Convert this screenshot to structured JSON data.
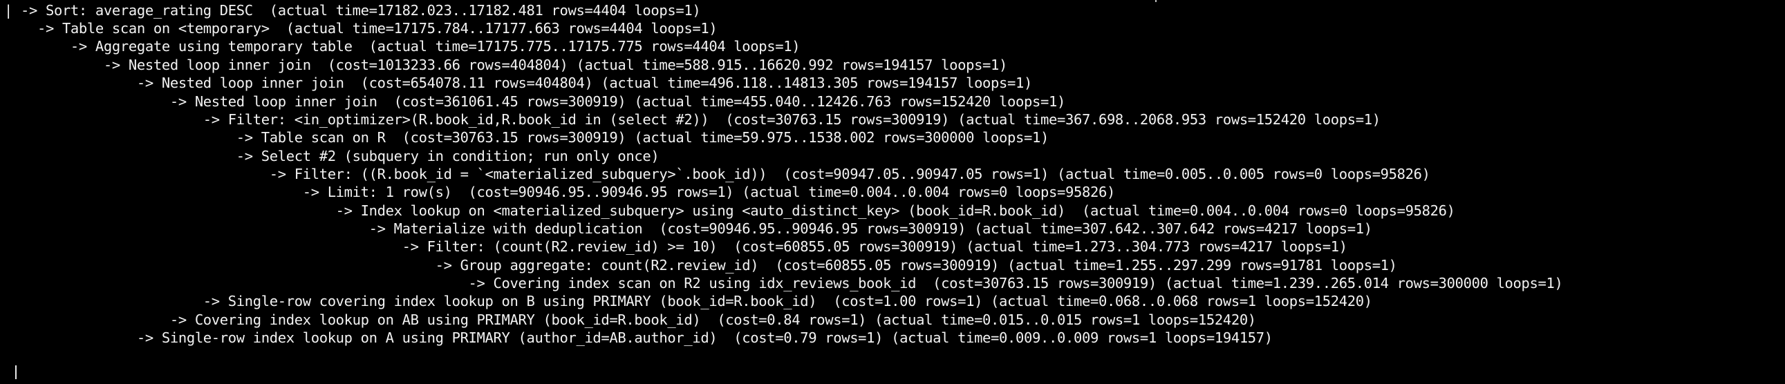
{
  "terminal": {
    "lines": [
      "| -> Sort: average_rating DESC  (actual time=17182.023..17182.481 rows=4404 loops=1)",
      "    -> Table scan on <temporary>  (actual time=17175.784..17177.663 rows=4404 loops=1)",
      "        -> Aggregate using temporary table  (actual time=17175.775..17175.775 rows=4404 loops=1)",
      "            -> Nested loop inner join  (cost=1013233.66 rows=404804) (actual time=588.915..16620.992 rows=194157 loops=1)",
      "                -> Nested loop inner join  (cost=654078.11 rows=404804) (actual time=496.118..14813.305 rows=194157 loops=1)",
      "                    -> Nested loop inner join  (cost=361061.45 rows=300919) (actual time=455.040..12426.763 rows=152420 loops=1)",
      "                        -> Filter: <in_optimizer>(R.book_id,R.book_id in (select #2))  (cost=30763.15 rows=300919) (actual time=367.698..2068.953 rows=152420 loops=1)",
      "                            -> Table scan on R  (cost=30763.15 rows=300919) (actual time=59.975..1538.002 rows=300000 loops=1)",
      "                            -> Select #2 (subquery in condition; run only once)",
      "                                -> Filter: ((R.book_id = `<materialized_subquery>`.book_id))  (cost=90947.05..90947.05 rows=1) (actual time=0.005..0.005 rows=0 loops=95826)",
      "                                    -> Limit: 1 row(s)  (cost=90946.95..90946.95 rows=1) (actual time=0.004..0.004 rows=0 loops=95826)",
      "                                        -> Index lookup on <materialized_subquery> using <auto_distinct_key> (book_id=R.book_id)  (actual time=0.004..0.004 rows=0 loops=95826)",
      "                                            -> Materialize with deduplication  (cost=90946.95..90946.95 rows=300919) (actual time=307.642..307.642 rows=4217 loops=1)",
      "                                                -> Filter: (count(R2.review_id) >= 10)  (cost=60855.05 rows=300919) (actual time=1.273..304.773 rows=4217 loops=1)",
      "                                                    -> Group aggregate: count(R2.review_id)  (cost=60855.05 rows=300919) (actual time=1.255..297.299 rows=91781 loops=1)",
      "                                                        -> Covering index scan on R2 using idx_reviews_book_id  (cost=30763.15 rows=300919) (actual time=1.239..265.014 rows=300000 loops=1)",
      "                        -> Single-row covering index lookup on B using PRIMARY (book_id=R.book_id)  (cost=1.00 rows=1) (actual time=0.068..0.068 rows=1 loops=152420)",
      "                    -> Covering index lookup on AB using PRIMARY (book_id=R.book_id)  (cost=0.84 rows=1) (actual time=0.015..0.015 rows=1 loops=152420)",
      "                -> Single-row index lookup on A using PRIMARY (author_id=AB.author_id)  (cost=0.79 rows=1) (actual time=0.009..0.009 rows=1 loops=194157)"
    ]
  },
  "colors": {
    "background": "#000000",
    "text": "#f2f2f2"
  }
}
